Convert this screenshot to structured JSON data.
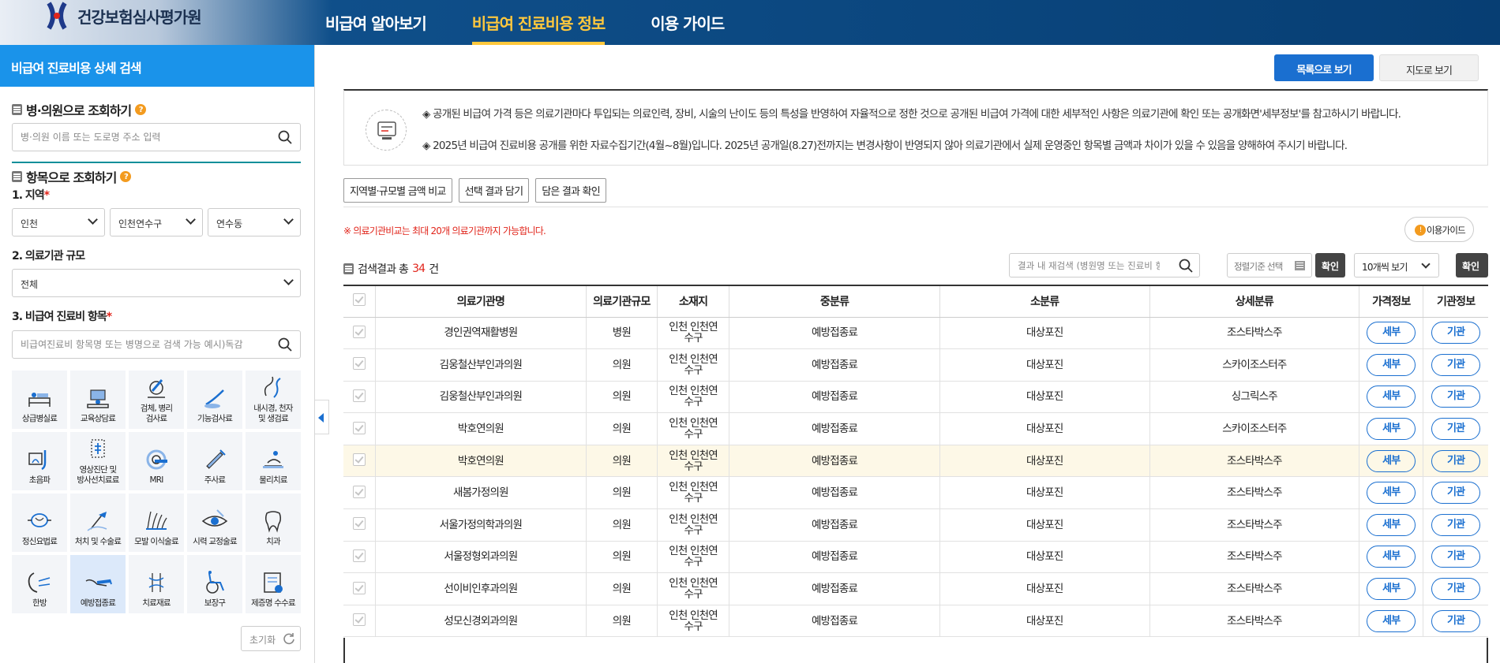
{
  "header": {
    "logo_text": "건강보험심사평가원",
    "nav": [
      "비급여 알아보기",
      "비급여 진료비용 정보",
      "이용 가이드"
    ],
    "active_nav": 1
  },
  "sidebar": {
    "title": "비급여 진료비용 상세 검색",
    "hospital_search": {
      "title": "병·의원으로 조회하기",
      "placeholder": "병·의원 이름 또는 도로명 주소 입력"
    },
    "item_search": {
      "title": "항목으로 조회하기"
    },
    "region": {
      "label": "1. 지역",
      "selects": [
        "인천",
        "인천연수구",
        "연수동"
      ]
    },
    "scale": {
      "label": "2. 의료기관 규모",
      "value": "전체"
    },
    "items": {
      "label": "3. 비급여 진료비 항목",
      "placeholder": "비급여진료비 항목명 또는 병명으로 검색 가능 예시)독감"
    },
    "categories": [
      {
        "label": "상급병실료",
        "icon": "hospital-bed-icon"
      },
      {
        "label": "교육상담료",
        "icon": "consultation-icon"
      },
      {
        "label": "검체, 병리\n검사료",
        "icon": "microscope-icon"
      },
      {
        "label": "기능검사료",
        "icon": "function-test-icon"
      },
      {
        "label": "내시경, 천자\n및 생검료",
        "icon": "endoscope-icon"
      },
      {
        "label": "초음파",
        "icon": "ultrasound-icon"
      },
      {
        "label": "영상진단 및\n방사선치료료",
        "icon": "radiology-icon"
      },
      {
        "label": "MRI",
        "icon": "mri-icon"
      },
      {
        "label": "주사료",
        "icon": "syringe-icon"
      },
      {
        "label": "물리치료",
        "icon": "physical-therapy-icon"
      },
      {
        "label": "정신요법료",
        "icon": "brain-icon"
      },
      {
        "label": "처치 및 수술료",
        "icon": "surgery-icon"
      },
      {
        "label": "모발 이식술료",
        "icon": "hair-icon"
      },
      {
        "label": "시력 교정술료",
        "icon": "eye-icon"
      },
      {
        "label": "치과",
        "icon": "tooth-icon"
      },
      {
        "label": "한방",
        "icon": "acupuncture-icon"
      },
      {
        "label": "예방접종료",
        "icon": "vaccine-icon"
      },
      {
        "label": "치료재료",
        "icon": "treatment-material-icon"
      },
      {
        "label": "보장구",
        "icon": "wheelchair-icon"
      },
      {
        "label": "제증명 수수료",
        "icon": "certificate-icon"
      }
    ],
    "selected_category": 16,
    "reset_label": "초기화"
  },
  "main": {
    "view_list": "목록으로 보기",
    "view_map": "지도로 보기",
    "notice": [
      "◈ 공개된 비급여 가격 등은 의료기관마다 투입되는 의료인력, 장비, 시술의 난이도 등의 특성을 반영하여 자율적으로 정한 것으로 공개된 비급여 가격에 대한 세부적인 사항은 의료기관에 확인 또는 공개화면'세부정보'를 참고하시기 바랍니다.",
      "◈ 2025년 비급여 진료비용 공개를 위한 자료수집기간(4월~8월)입니다. 2025년 공개일(8.27)전까지는 변경사항이 반영되지 않아 의료기관에서 실제 운영중인 항목별 금액과 차이가 있을 수 있음을 양해하여 주시기 바랍니다."
    ],
    "buttons": [
      "지역별·규모별 금액 비교",
      "선택 결과 담기",
      "담은 결과 확인"
    ],
    "warning": "※ 의료기관비교는 최대 20개 의료기관까지 가능합니다.",
    "guide_label": "이용가이드",
    "result": {
      "prefix": "검색결과 총",
      "count": "34",
      "suffix": "건"
    },
    "result_search_placeholder": "결과 내 재검색 (병원명 또는 진료비 항목)",
    "sort_label": "정렬기준 선택",
    "confirm": "확인",
    "per_page": "10개씩 보기",
    "columns": [
      "의료기관명",
      "의료기관규모",
      "소재지",
      "중분류",
      "소분류",
      "상세분류",
      "가격정보",
      "기관정보"
    ],
    "detail_label": "세부",
    "inst_label": "기관",
    "rows": [
      {
        "name": "경인권역재활병원",
        "scale": "병원",
        "loc": "인천 인천연\n수구",
        "mid": "예방접종료",
        "small": "대상포진",
        "detail": "조스타박스주"
      },
      {
        "name": "김웅철산부인과의원",
        "scale": "의원",
        "loc": "인천 인천연\n수구",
        "mid": "예방접종료",
        "small": "대상포진",
        "detail": "스카이조스터주"
      },
      {
        "name": "김웅철산부인과의원",
        "scale": "의원",
        "loc": "인천 인천연\n수구",
        "mid": "예방접종료",
        "small": "대상포진",
        "detail": "싱그릭스주"
      },
      {
        "name": "박호연의원",
        "scale": "의원",
        "loc": "인천 인천연\n수구",
        "mid": "예방접종료",
        "small": "대상포진",
        "detail": "스카이조스터주"
      },
      {
        "name": "박호연의원",
        "scale": "의원",
        "loc": "인천 인천연\n수구",
        "mid": "예방접종료",
        "small": "대상포진",
        "detail": "조스타박스주"
      },
      {
        "name": "새봄가정의원",
        "scale": "의원",
        "loc": "인천 인천연\n수구",
        "mid": "예방접종료",
        "small": "대상포진",
        "detail": "조스타박스주"
      },
      {
        "name": "서울가정의학과의원",
        "scale": "의원",
        "loc": "인천 인천연\n수구",
        "mid": "예방접종료",
        "small": "대상포진",
        "detail": "조스타박스주"
      },
      {
        "name": "서울정형외과의원",
        "scale": "의원",
        "loc": "인천 인천연\n수구",
        "mid": "예방접종료",
        "small": "대상포진",
        "detail": "조스타박스주"
      },
      {
        "name": "선이비인후과의원",
        "scale": "의원",
        "loc": "인천 인천연\n수구",
        "mid": "예방접종료",
        "small": "대상포진",
        "detail": "조스타박스주"
      },
      {
        "name": "성모신경외과의원",
        "scale": "의원",
        "loc": "인천 인천연\n수구",
        "mid": "예방접종료",
        "small": "대상포진",
        "detail": "조스타박스주"
      }
    ],
    "highlight_row": 4
  },
  "colors": {
    "primary": "#1a6fd0",
    "sidebar_head": "#1a93ea",
    "nav_active": "#ffc83d",
    "header_dark": "#073e73",
    "warn": "#e1251b"
  }
}
